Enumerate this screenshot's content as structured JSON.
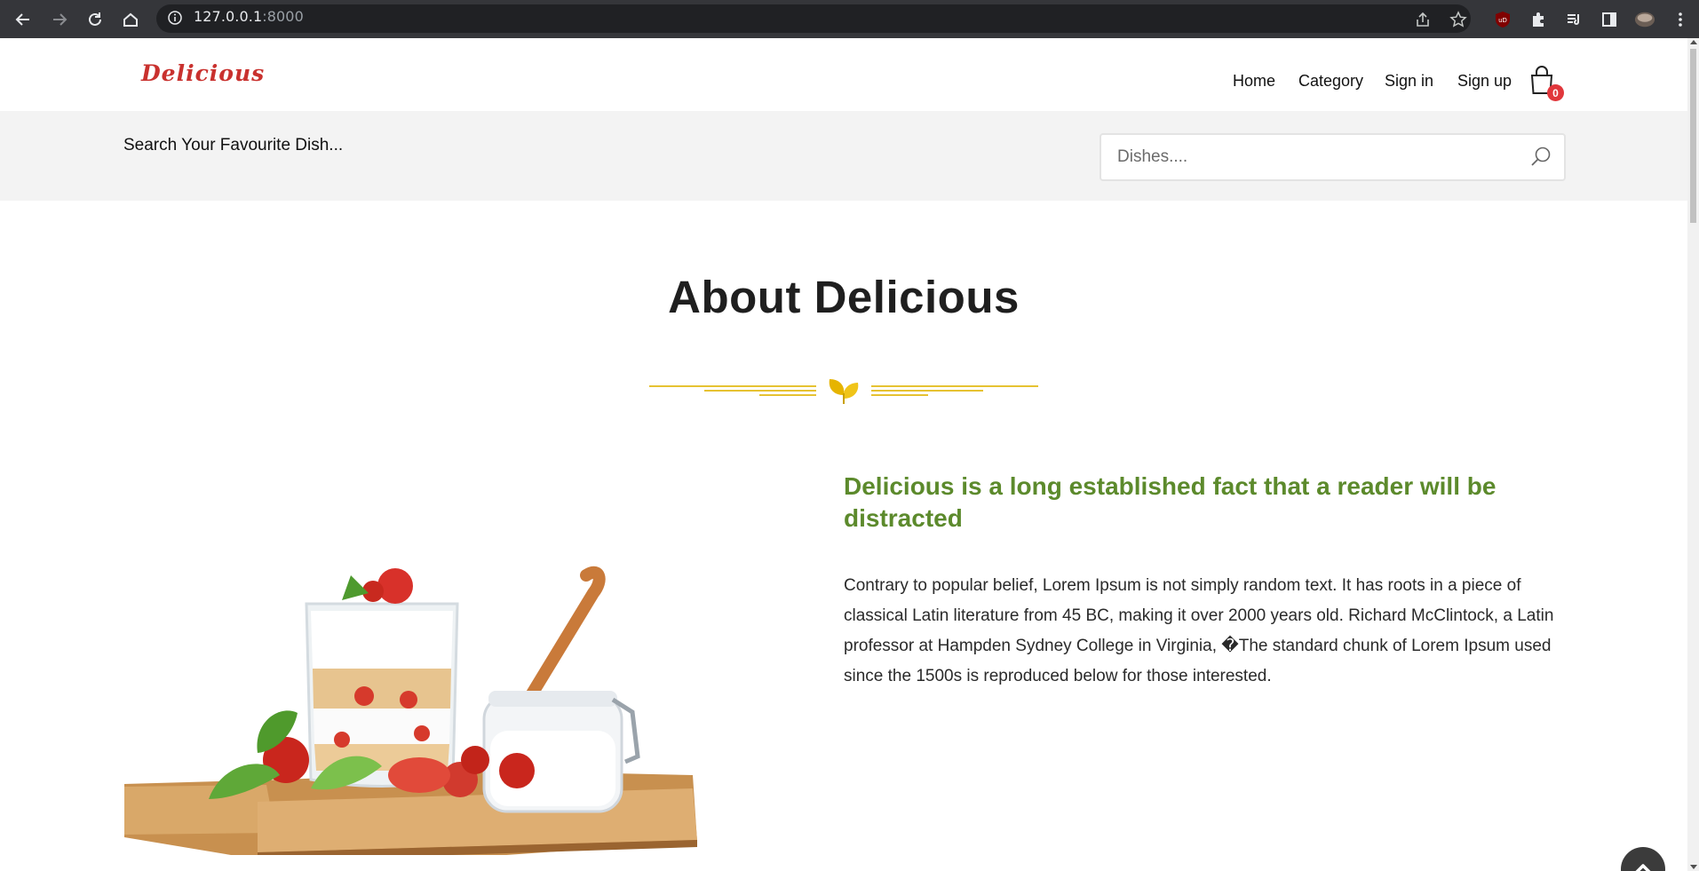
{
  "browser": {
    "url_host": "127.0.0.1",
    "url_port": ":8000"
  },
  "header": {
    "logo": "Delicious",
    "nav": [
      {
        "label": "Home"
      },
      {
        "label": "Category"
      },
      {
        "label": "Sign in"
      },
      {
        "label": "Sign up"
      }
    ],
    "cart_count": "0"
  },
  "search": {
    "label": "Search Your Favourite Dish...",
    "placeholder": "Dishes...."
  },
  "about": {
    "title": "About Delicious",
    "subheading": "Delicious is a long established fact that a reader will be distracted",
    "paragraph": "Contrary to popular belief, Lorem Ipsum is not simply random text. It has roots in a piece of classical Latin literature from 45 BC, making it over 2000 years old. Richard McClintock, a Latin professor at Hampden Sydney College in Virginia, �The standard chunk of Lorem Ipsum used since the 1500s is reproduced below for those interested."
  },
  "colors": {
    "logo": "#c9312e",
    "subheading": "#5c8a2c",
    "divider_gold": "#e6c232",
    "badge": "#e1373c"
  },
  "icons": {
    "cart": "shopping-bag-icon",
    "search": "search-icon",
    "to_top": "chevron-up-icon"
  }
}
